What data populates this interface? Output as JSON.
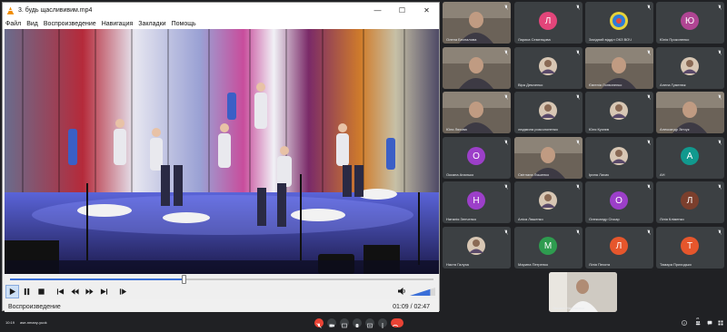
{
  "player": {
    "title": "3. будь щаслививим.mp4",
    "menu": [
      "Файл",
      "Вид",
      "Воспроизведение",
      "Навигация",
      "Закладки",
      "Помощь"
    ],
    "status": "Воспроизведение",
    "time": "01:09 / 02:47",
    "progress": 0.41,
    "volume": 0.8
  },
  "participants": [
    {
      "name": "Олена Беспалова",
      "kind": "video"
    },
    {
      "name": "Лариса Семенцова",
      "kind": "avatar",
      "letter": "Л",
      "color": "#e3457a"
    },
    {
      "name": "Західний відділ ОКЗ ВОЧ",
      "kind": "logo"
    },
    {
      "name": "Юлія Прокопенко",
      "kind": "avatar",
      "letter": "Ю",
      "color": "#b04593"
    },
    {
      "name": "",
      "kind": "video"
    },
    {
      "name": "Віра Демченко",
      "kind": "photo"
    },
    {
      "name": "Євгенія Логвиненко",
      "kind": "video"
    },
    {
      "name": "Алена Гуменюк",
      "kind": "photo"
    },
    {
      "name": "Юля Ляхова",
      "kind": "video"
    },
    {
      "name": "людмила розсолоненко",
      "kind": "photo"
    },
    {
      "name": "Юля Кузнєв",
      "kind": "photo"
    },
    {
      "name": "Александр Зінчук",
      "kind": "video"
    },
    {
      "name": "Оксана Апалько",
      "kind": "avatar",
      "letter": "О",
      "color": "#9c3fc9"
    },
    {
      "name": "Світлана Ляшенко",
      "kind": "video"
    },
    {
      "name": "Ірина Лисик",
      "kind": "photo"
    },
    {
      "name": "АН",
      "kind": "avatar",
      "letter": "А",
      "color": "#11998e"
    },
    {
      "name": "Наталія Зенченко",
      "kind": "avatar",
      "letter": "Н",
      "color": "#9c3fc9"
    },
    {
      "name": "Аліса Ляшенко",
      "kind": "photo"
    },
    {
      "name": "Олександр Січкар",
      "kind": "avatar",
      "letter": "О",
      "color": "#9c3fc9"
    },
    {
      "name": "Лілія Кліменко",
      "kind": "avatar",
      "letter": "Л",
      "color": "#7b3f2d"
    },
    {
      "name": "Настя Галуха",
      "kind": "photo"
    },
    {
      "name": "Марина Петренко",
      "kind": "avatar",
      "letter": "М",
      "color": "#2e9c4f"
    },
    {
      "name": "Лілія Пехота",
      "kind": "avatar",
      "letter": "Л",
      "color": "#e6562c"
    },
    {
      "name": "Тамара Приходько",
      "kind": "avatar",
      "letter": "Т",
      "color": "#e6562c"
    }
  ],
  "self_view": {
    "name": "Оксана Ніколаєнко"
  },
  "meetbar": {
    "clock": "10:19",
    "code": "ase-nmany-yuok",
    "people_count": "25"
  }
}
